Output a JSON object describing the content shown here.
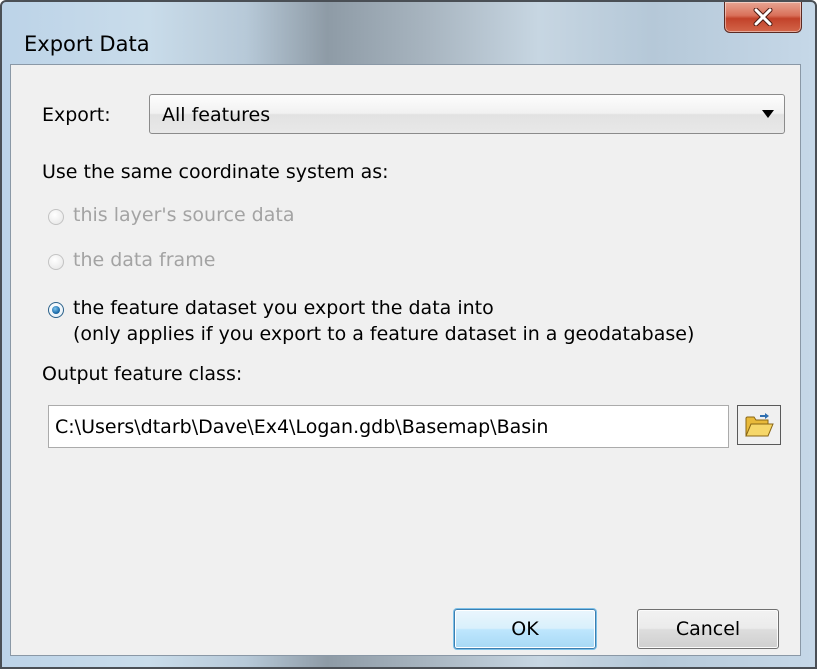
{
  "window": {
    "title": "Export Data"
  },
  "export_row": {
    "label": "Export:",
    "selected": "All features"
  },
  "coord_group": {
    "heading": "Use the same coordinate system as:",
    "options": [
      {
        "label": "this layer's source data",
        "checked": false,
        "enabled": false
      },
      {
        "label": "the data frame",
        "checked": false,
        "enabled": false
      },
      {
        "label": "the feature dataset you export the data into",
        "sublabel": "(only applies if you export to a feature dataset in a geodatabase)",
        "checked": true,
        "enabled": true
      }
    ]
  },
  "output": {
    "label": "Output feature class:",
    "value": "C:\\Users\\dtarb\\Dave\\Ex4\\Logan.gdb\\Basemap\\Basin"
  },
  "buttons": {
    "ok_label": "OK",
    "cancel_label": "Cancel"
  },
  "icons": {
    "close": "close-x-icon",
    "browse": "open-folder-icon",
    "dropdown": "dropdown-arrow-icon"
  },
  "colors": {
    "close_button": "#c9503a",
    "selected_radio": "#1f6fad",
    "ok_highlight": "#3c7fb1",
    "dialog_bg": "#f0f0f0"
  }
}
